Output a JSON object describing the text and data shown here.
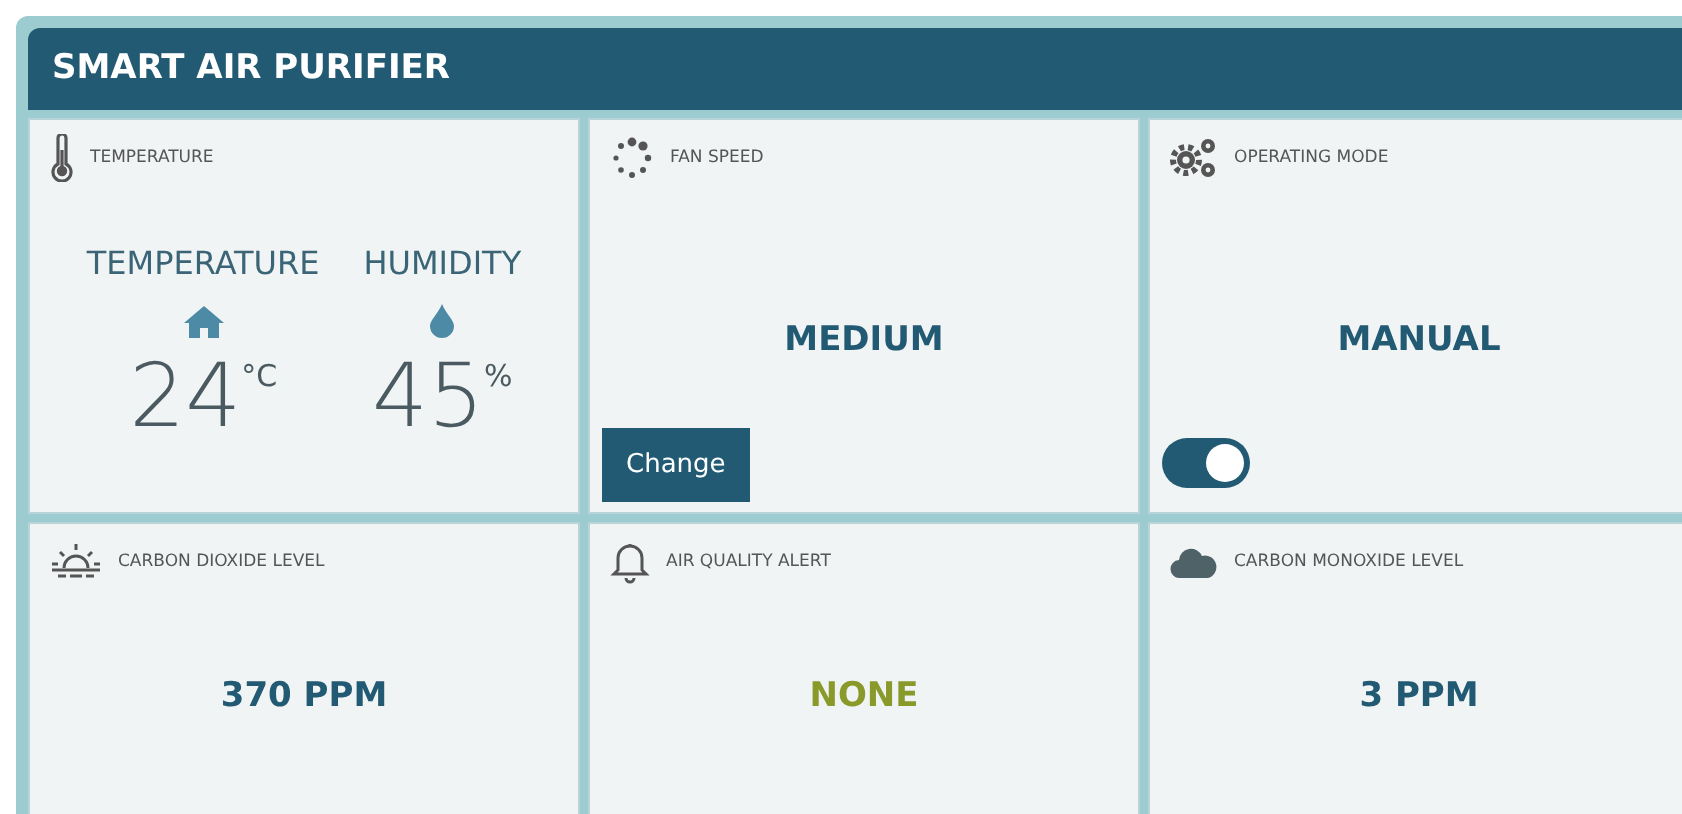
{
  "header": {
    "title": "SMART AIR PURIFIER"
  },
  "tiles": [
    {
      "kind": "climate",
      "label": "TEMPERATURE",
      "readings": [
        {
          "label": "TEMPERATURE",
          "value": "24",
          "unit": "°C"
        },
        {
          "label": "HUMIDITY",
          "value": "45",
          "unit": "%"
        }
      ]
    },
    {
      "kind": "value",
      "label": "FAN SPEED",
      "value": "MEDIUM",
      "color": "#215a72",
      "button": "Change"
    },
    {
      "kind": "value",
      "label": "OPERATING MODE",
      "value": "MANUAL",
      "color": "#215a72",
      "toggle": {
        "on": true
      }
    },
    {
      "kind": "value",
      "label": "CARBON DIOXIDE LEVEL",
      "value": "370 PPM",
      "color": "#215a72"
    },
    {
      "kind": "value",
      "label": "AIR QUALITY ALERT",
      "value": "NONE",
      "color": "#8a9a2a"
    },
    {
      "kind": "value",
      "label": "CARBON MONOXIDE LEVEL",
      "value": "3 PPM",
      "color": "#215a72"
    }
  ]
}
